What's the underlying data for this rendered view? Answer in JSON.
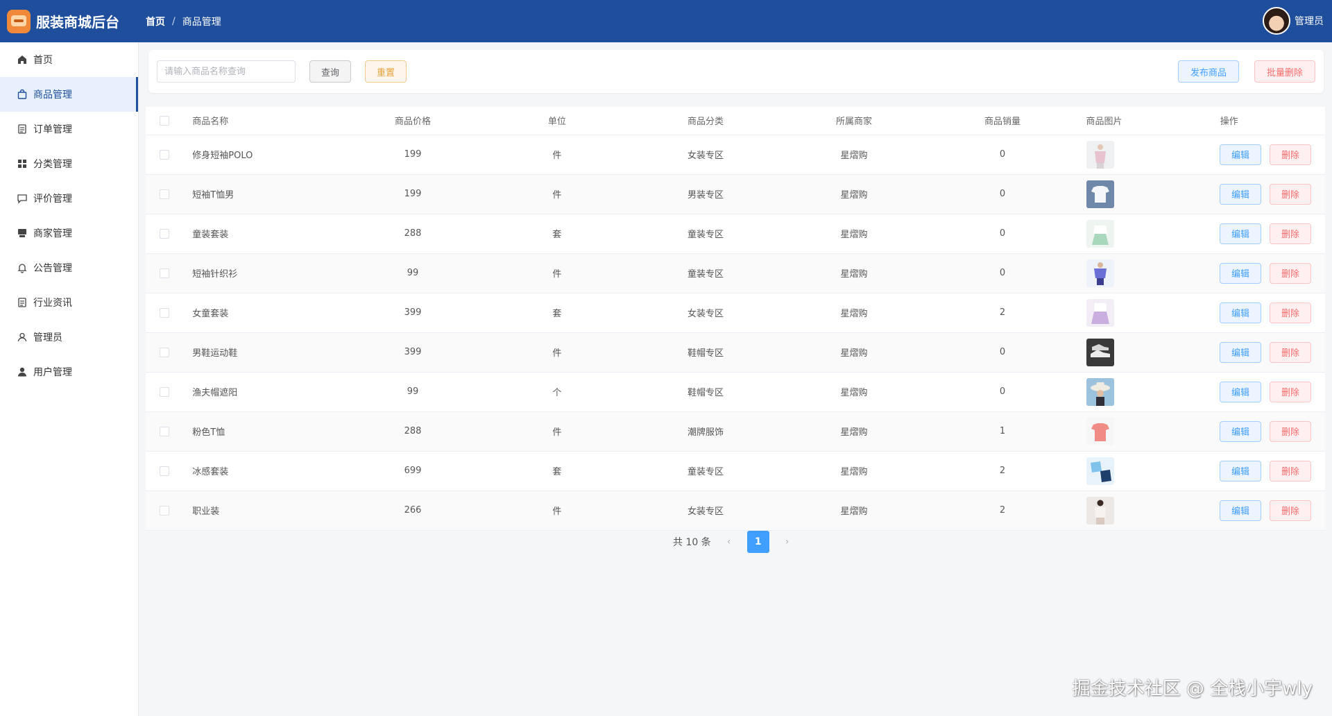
{
  "header": {
    "app_title": "服装商城后台",
    "breadcrumb": [
      "首页",
      "商品管理"
    ],
    "user_name": "管理员",
    "bg_color": "#1e4e9c"
  },
  "sidebar": {
    "items": [
      {
        "label": "首页",
        "icon": "home-icon"
      },
      {
        "label": "商品管理",
        "icon": "bag-icon",
        "active": true
      },
      {
        "label": "订单管理",
        "icon": "document-icon"
      },
      {
        "label": "分类管理",
        "icon": "grid-icon"
      },
      {
        "label": "评价管理",
        "icon": "chat-icon"
      },
      {
        "label": "商家管理",
        "icon": "store-icon"
      },
      {
        "label": "公告管理",
        "icon": "bell-icon"
      },
      {
        "label": "行业资讯",
        "icon": "document-icon"
      },
      {
        "label": "管理员",
        "icon": "user-outline-icon"
      },
      {
        "label": "用户管理",
        "icon": "user-solid-icon"
      }
    ]
  },
  "search": {
    "placeholder": "请输入商品名称查询",
    "query_label": "查询",
    "reset_label": "重置",
    "publish_label": "发布商品",
    "batch_delete_label": "批量删除"
  },
  "table": {
    "columns": [
      "商品名称",
      "商品价格",
      "单位",
      "商品分类",
      "所属商家",
      "商品销量",
      "商品图片",
      "操作"
    ],
    "edit_label": "编辑",
    "delete_label": "删除",
    "rows": [
      {
        "name": "修身短袖POLO",
        "price": "199",
        "unit": "件",
        "category": "女装专区",
        "shop": "星熠购",
        "sales": "0",
        "image": "pink-polo"
      },
      {
        "name": "短袖T恤男",
        "price": "199",
        "unit": "件",
        "category": "男装专区",
        "shop": "星熠购",
        "sales": "0",
        "image": "white-tee"
      },
      {
        "name": "童装套装",
        "price": "288",
        "unit": "套",
        "category": "童装专区",
        "shop": "星熠购",
        "sales": "0",
        "image": "kids-set"
      },
      {
        "name": "短袖针织衫",
        "price": "99",
        "unit": "件",
        "category": "童装专区",
        "shop": "星熠购",
        "sales": "0",
        "image": "purple-knit"
      },
      {
        "name": "女童套装",
        "price": "399",
        "unit": "套",
        "category": "女装专区",
        "shop": "星熠购",
        "sales": "2",
        "image": "girl-set"
      },
      {
        "name": "男鞋运动鞋",
        "price": "399",
        "unit": "件",
        "category": "鞋帽专区",
        "shop": "星熠购",
        "sales": "0",
        "image": "sneakers"
      },
      {
        "name": "渔夫帽遮阳",
        "price": "99",
        "unit": "个",
        "category": "鞋帽专区",
        "shop": "星熠购",
        "sales": "0",
        "image": "bucket-hat"
      },
      {
        "name": "粉色T恤",
        "price": "288",
        "unit": "件",
        "category": "潮牌服饰",
        "shop": "星熠购",
        "sales": "1",
        "image": "pink-tee"
      },
      {
        "name": "冰感套装",
        "price": "699",
        "unit": "套",
        "category": "童装专区",
        "shop": "星熠购",
        "sales": "2",
        "image": "ice-set"
      },
      {
        "name": "职业装",
        "price": "266",
        "unit": "件",
        "category": "女装专区",
        "shop": "星熠购",
        "sales": "2",
        "image": "office-wear"
      }
    ]
  },
  "pagination": {
    "total_text": "共 10 条",
    "current_page": "1",
    "prev_icon": "chevron-left-icon",
    "next_icon": "chevron-right-icon"
  },
  "watermark": "掘金技术社区 @ 全栈小宇wly"
}
